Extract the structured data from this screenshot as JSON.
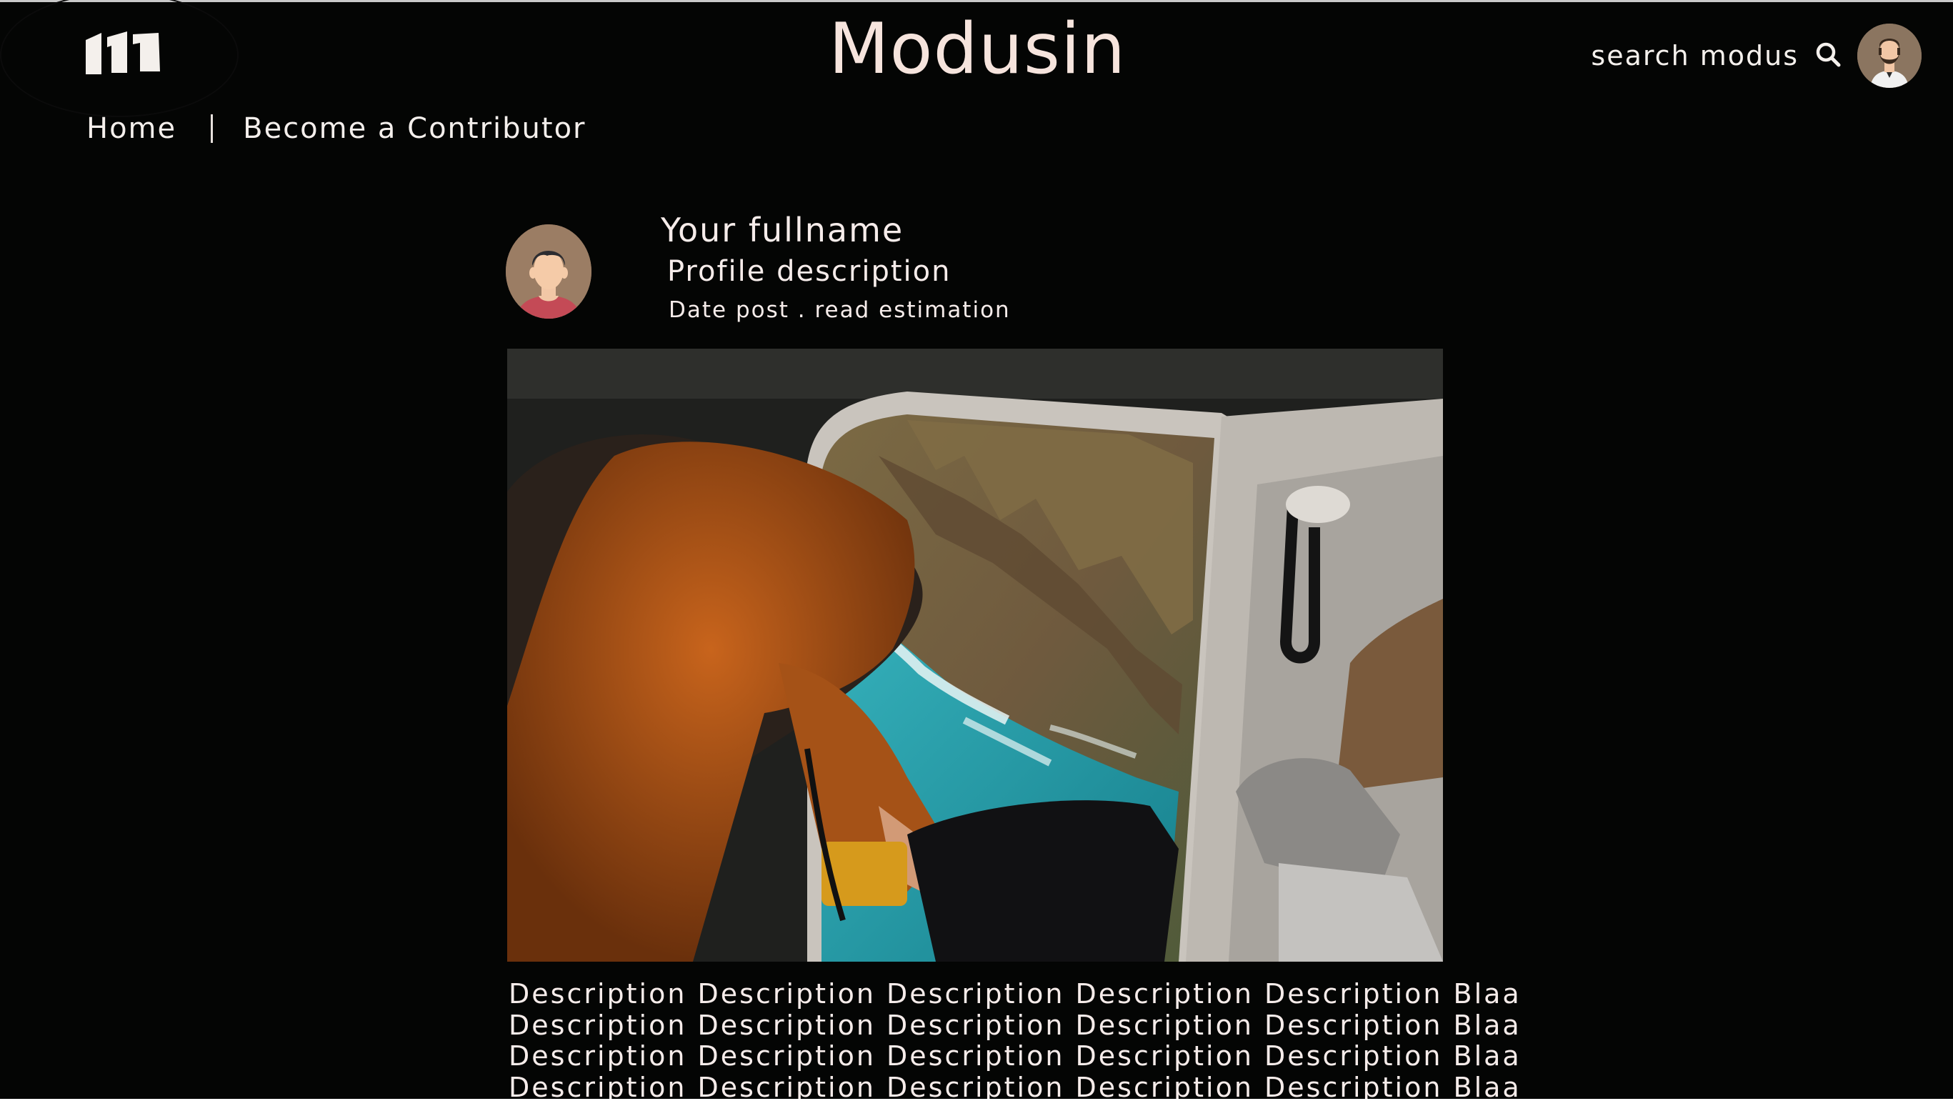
{
  "header": {
    "logo_icon": "modusin-m-logo-icon",
    "site_title": "Modusin",
    "search_label": "search modus",
    "search_icon": "search-icon",
    "user_avatar_icon": "bearded-man-avatar-icon"
  },
  "nav": {
    "items": [
      {
        "label": "Home"
      },
      {
        "label": "Become a Contributor"
      }
    ]
  },
  "author": {
    "avatar_icon": "person-avatar-icon",
    "fullname": "Your fullname",
    "description": "Profile description",
    "meta": "Date post .  read estimation"
  },
  "hero_image": {
    "description": "person in orange hoodie looking out of helicopter door over coastline"
  },
  "article": {
    "lines": [
      "Description Description Description Description Description Blaa",
      "Description Description Description Description Description Blaa",
      "Description Description Description Description Description Blaa",
      "Description Description Description Description Description Blaa"
    ]
  },
  "colors": {
    "background": "#040504",
    "text": "#f6ecea",
    "accent_orange": "#c2641c",
    "sea": "#2aa7b2"
  }
}
